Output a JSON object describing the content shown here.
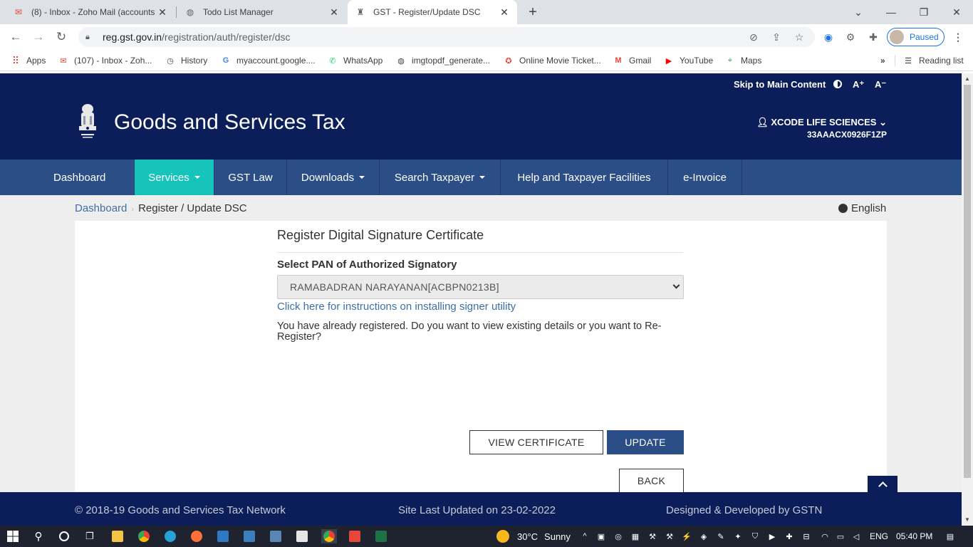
{
  "browser": {
    "tabs": [
      {
        "label": "(8) - Inbox - Zoho Mail (accounts",
        "icon": "zoho-mail-icon"
      },
      {
        "label": "Todo List Manager",
        "icon": "globe-icon"
      },
      {
        "label": "GST - Register/Update DSC",
        "icon": "gst-emblem-icon"
      }
    ],
    "url_domain": "reg.gst.gov.in",
    "url_path": "/registration/auth/register/dsc",
    "profile_status": "Paused",
    "bookmarks": [
      "Apps",
      "(107) - Inbox - Zoh...",
      "History",
      "myaccount.google....",
      "WhatsApp",
      "imgtopdf_generate...",
      "Online Movie Ticket...",
      "Gmail",
      "YouTube",
      "Maps"
    ],
    "more_bookmarks": "»",
    "reading_list": "Reading list"
  },
  "topstrip": {
    "skip": "Skip to Main Content",
    "font_increase": "A⁺",
    "font_decrease": "A⁻"
  },
  "header": {
    "title": "Goods and Services Tax",
    "user": "XCODE LIFE SCIENCES",
    "gstin": "33AAACX0926F1ZP"
  },
  "nav": {
    "items": [
      {
        "label": "Dashboard",
        "dropdown": false,
        "active": false
      },
      {
        "label": "Services",
        "dropdown": true,
        "active": true
      },
      {
        "label": "GST Law",
        "dropdown": false,
        "active": false
      },
      {
        "label": "Downloads",
        "dropdown": true,
        "active": false
      },
      {
        "label": "Search Taxpayer",
        "dropdown": true,
        "active": false
      },
      {
        "label": "Help and Taxpayer Facilities",
        "dropdown": false,
        "active": false
      },
      {
        "label": "e-Invoice",
        "dropdown": false,
        "active": false
      }
    ]
  },
  "breadcrumb": {
    "home": "Dashboard",
    "current": "Register / Update DSC"
  },
  "language": "English",
  "form": {
    "title": "Register Digital Signature Certificate",
    "pan_label": "Select PAN of Authorized Signatory",
    "pan_selected": "RAMABADRAN NARAYANAN[ACBPN0213B]",
    "instructions_link": "Click here for instructions on installing signer utility",
    "message": "You have already registered. Do you want to view existing details or you want to Re-Register?",
    "view_button": "VIEW CERTIFICATE",
    "update_button": "UPDATE",
    "back_button": "BACK"
  },
  "footer": {
    "copyright": "© 2018-19 Goods and Services Tax Network",
    "updated": "Site Last Updated on 23-02-2022",
    "credits": "Designed & Developed by GSTN"
  },
  "taskbar": {
    "weather_temp": "30°C",
    "weather_desc": "Sunny",
    "language": "ENG",
    "time": "05:40 PM"
  },
  "colors": {
    "header_bg": "#0b1e59",
    "nav_bg": "#2c4e86",
    "nav_active": "#17c4bb",
    "link": "#3f6fa8"
  }
}
